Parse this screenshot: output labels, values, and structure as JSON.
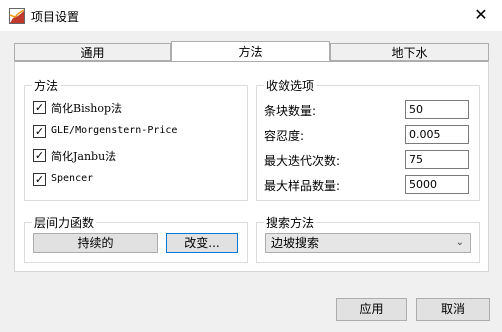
{
  "window": {
    "title": "项目设置",
    "close_glyph": "✕"
  },
  "tabs": [
    {
      "label": "通用",
      "active": false
    },
    {
      "label": "方法",
      "active": true
    },
    {
      "label": "地下水",
      "active": false
    }
  ],
  "methods_group": {
    "title": "方法",
    "items": [
      {
        "label": "简化Bishop法",
        "checked": true
      },
      {
        "label": "GLE/Morgenstern-Price",
        "checked": true
      },
      {
        "label": "简化Janbu法",
        "checked": true
      },
      {
        "label": "Spencer",
        "checked": true
      }
    ]
  },
  "convergence_group": {
    "title": "收敛选项",
    "fields": [
      {
        "label": "条块数量:",
        "value": "50"
      },
      {
        "label": "容忍度:",
        "value": "0.005"
      },
      {
        "label": "最大迭代次数:",
        "value": "75"
      },
      {
        "label": "最大样品数量:",
        "value": "5000"
      }
    ]
  },
  "interslice_group": {
    "title": "层间力函数",
    "function_button": "持续的",
    "change_button": "改变..."
  },
  "search_group": {
    "title": "搜索方法",
    "selected": "边坡搜索"
  },
  "footer": {
    "apply": "应用",
    "cancel": "取消"
  },
  "colors": {
    "accent": "#0078d7",
    "window_bg": "#f0f0f0"
  },
  "icons": {
    "app": "slope-app-icon",
    "checkbox": "check-icon",
    "dropdown": "chevron-down-icon"
  }
}
